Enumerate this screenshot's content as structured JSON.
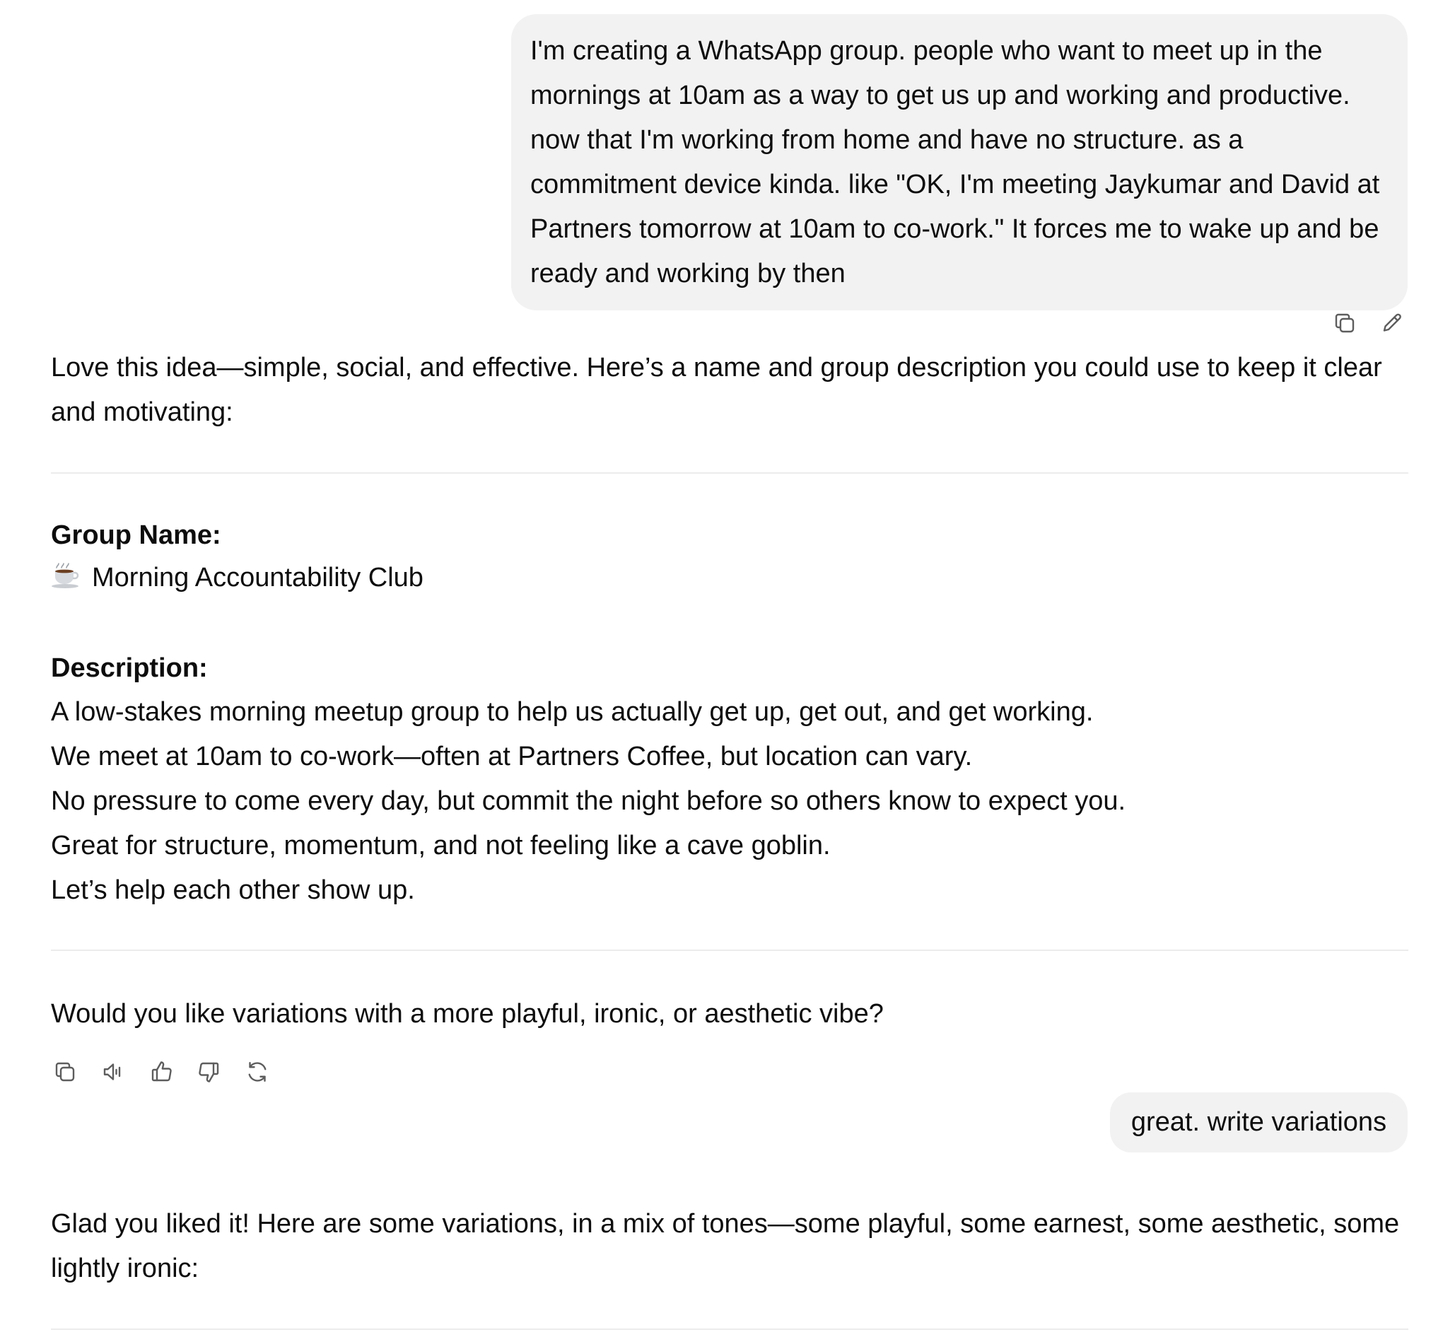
{
  "conversation": {
    "user_message_1": {
      "lines": [
        "I'm creating a WhatsApp group. people who want to meet up in the",
        "mornings at 10am as a way to get us up and working and productive.",
        "now that I'm working from home and have no structure. as a",
        "commitment device kinda. like \"OK, I'm meeting Jaykumar and David at",
        "Partners tomorrow at 10am to co-work.\" It forces me to wake up and be",
        "ready and working by then"
      ]
    },
    "user_actions": {
      "copy_icon": "copy-icon",
      "edit_icon": "pencil-icon"
    },
    "assistant_reply_1": {
      "intro_lines": [
        "Love this idea—simple, social, and effective. Here’s a name and group description you could use to keep it clear",
        "and motivating:"
      ],
      "group_name_label": "Group Name:",
      "group_name_emoji": "☕",
      "group_name_value": "Morning Accountability Club",
      "description_label": "Description:",
      "description_lines": [
        "A low-stakes morning meetup group to help us actually get up, get out, and get working.",
        "We meet at 10am to co-work—often at Partners Coffee, but location can vary.",
        "No pressure to come every day, but commit the night before so others know to expect you.",
        "Great for structure, momentum, and not feeling like a cave goblin.",
        "Let’s help each other show up."
      ],
      "follow_up": "Would you like variations with a more playful, ironic, or aesthetic vibe?"
    },
    "response_actions": {
      "copy_icon": "copy-icon",
      "read_aloud_icon": "speaker-icon",
      "thumbs_up_icon": "thumbs-up-icon",
      "thumbs_down_icon": "thumbs-down-icon",
      "regenerate_icon": "refresh-icon"
    },
    "user_message_2": {
      "text": "great. write variations"
    },
    "assistant_reply_2": {
      "lines": [
        "Glad you liked it! Here are some variations, in a mix of tones—some playful, some earnest, some aesthetic, some",
        "lightly ironic:"
      ]
    }
  },
  "colors": {
    "bubble_bg": "#f2f2f2",
    "text": "#0d0d0d",
    "icon": "#5d5d5d",
    "divider": "#ececec"
  }
}
